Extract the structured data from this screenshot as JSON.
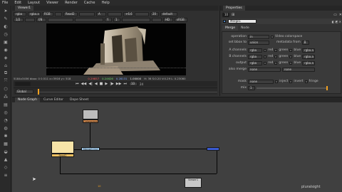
{
  "menu": [
    "File",
    "Edit",
    "Layout",
    "Viewer",
    "Render",
    "Cache",
    "Help"
  ],
  "toolbar_icons": [
    "pointer-icon",
    "paint-icon",
    "draw-icon",
    "time-icon",
    "channel-icon",
    "color-icon",
    "filter-icon",
    "keyer-icon",
    "merge-icon",
    "transform-icon",
    "3d-icon",
    "particles-icon",
    "deep-icon",
    "views-icon",
    "metadata-icon",
    "toolsets-icon",
    "other-icon",
    "cineframe-icon",
    "ocio-icon",
    "furnace-icon",
    "glass-icon",
    "more-icon"
  ],
  "viewer": {
    "tab": "Viewer1",
    "row1": [
      "rgba",
      "rgba.a",
      "RGB",
      "",
      "Read2",
      "",
      "A",
      "",
      "+6.6",
      "0",
      "20",
      "default"
    ],
    "row2": [
      "1/2",
      "",
      "f/8",
      "1",
      "",
      "Y",
      "1",
      "",
      "",
      "HD",
      "sRGB"
    ],
    "info": "5184x3456 bbox: 0 0.511   x=3916 y= 518",
    "color_values": [
      "0.29857",
      "0.24626",
      "0.28131",
      "1.00000"
    ],
    "hsv": "H: 36 S:0.20 V:0.29  L: 0.23080",
    "frame": "10",
    "fps": "24",
    "scope": "Global"
  },
  "properties": {
    "tab": "Properties",
    "count": "10",
    "node_name": "Merge1",
    "tabs": [
      "Merge",
      "Node"
    ],
    "operation_label": "operation",
    "operation_value": "in",
    "video_colorspace_label": "Video colorspace",
    "set_bbox_label": "set bbox to",
    "set_bbox_value": "union",
    "metadata_from_label": "metadata from",
    "metadata_from_value": "B",
    "a_channels_label": "A channels",
    "b_channels_label": "B channels",
    "output_label": "output",
    "also_merge_label": "also merge",
    "channel_value": "rgba",
    "channel_names": [
      "red",
      "green",
      "blue",
      "alpha"
    ],
    "alpha_value": "rgba.a",
    "none_value": "none",
    "mask_label": "mask",
    "inject_label": "inject",
    "invert_label": "invert",
    "fringe_label": "fringe",
    "mix_label": "mix",
    "mix_value": "1"
  },
  "nodegraph": {
    "tabs": [
      "Node Graph",
      "Curve Editor",
      "Dope Sheet"
    ],
    "nodes": {
      "read_top": "Colorspace",
      "read_left": "Read2",
      "merge": "Merge1 (in)",
      "small_right": "",
      "bottom_right": "Viewer1"
    },
    "small_label": "10"
  },
  "watermark": "pluralsight",
  "colors": {
    "accent": "#f0a020",
    "read_node": "#f7e4a8",
    "merge_node": "#a0c8e8",
    "viewer_node": "#c8c8c8",
    "wire": "#050505"
  }
}
